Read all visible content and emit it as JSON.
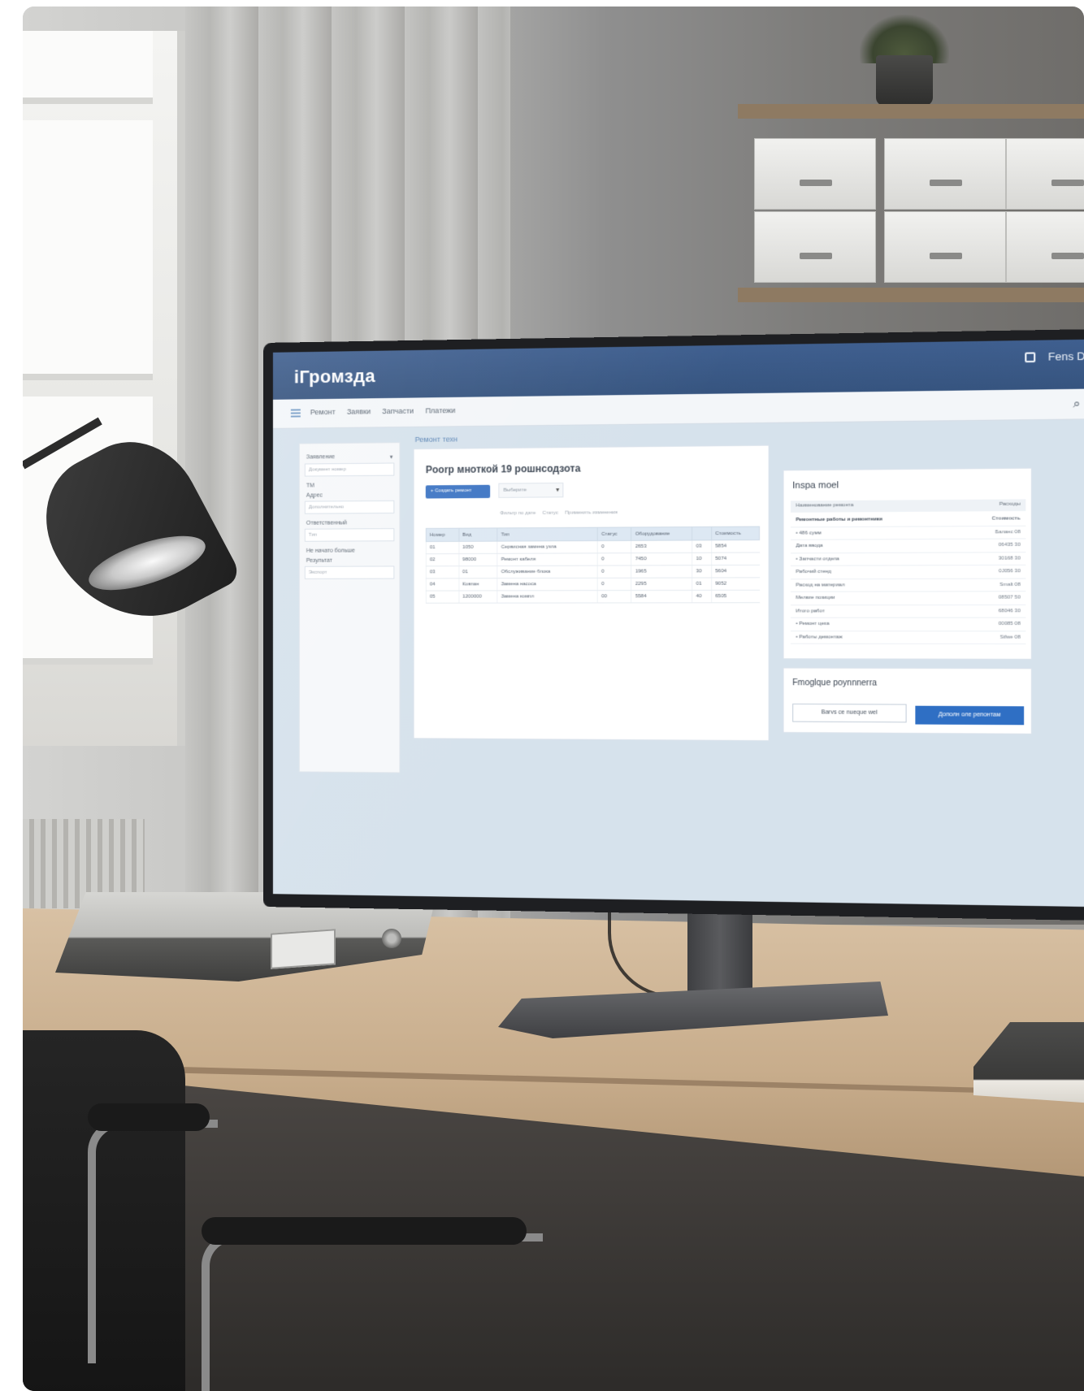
{
  "app": {
    "logo": "iГромзда",
    "user_name": "Fens Damoed"
  },
  "subnav": {
    "tabs": [
      "Ремонт",
      "Заявки",
      "Запчасти",
      "Платежи"
    ]
  },
  "sidebar": {
    "fields": [
      {
        "label": "Заявление",
        "value": "Документ номер"
      },
      {
        "label": "ТМ",
        "value": ""
      },
      {
        "label": "Адрес",
        "value": "Дополнительно"
      },
      {
        "label": "Ответственный",
        "value": "Тип"
      },
      {
        "label": "Не начато больше",
        "value": ""
      },
      {
        "label": "Результат",
        "value": "Экспорт"
      }
    ]
  },
  "main": {
    "breadcrumb": "Ремонт техн",
    "title": "Poorp мноткой 19 рошнсодзота",
    "primary_button": "+ Создать ремонт",
    "select_value": "Выберите",
    "filters": [
      "Фильтр по дате",
      "Статус",
      "Применить изменения"
    ],
    "table": {
      "headers": [
        "Номер",
        "Вид",
        "Тип",
        "",
        "Статус",
        "Оборудование",
        "",
        "Стоимость"
      ],
      "rows": [
        [
          "01",
          "1050",
          "Сервисная замена узла",
          "0",
          "2653",
          "03",
          "5854"
        ],
        [
          "02",
          "98000",
          "Ремонт кабеля",
          "0",
          "7450",
          "10",
          "5074"
        ],
        [
          "03",
          "01",
          "Обслуживание блока",
          "0",
          "1965",
          "30",
          "5604"
        ],
        [
          "04",
          "Ковпан",
          "Замена насоса",
          "0",
          "2295",
          "01",
          "9052"
        ],
        [
          "05",
          "1200000",
          "Замена компл",
          "00",
          "5584",
          "40",
          "6505"
        ]
      ]
    }
  },
  "right_panel": {
    "title": "Inspa moel",
    "head": [
      "Наименование ремонта",
      "Расходы"
    ],
    "rows": [
      {
        "label": "Ремонтные работы и ремонтники",
        "value": "Стоимость",
        "bold": true
      },
      {
        "label": "• 486 сумм",
        "value": "Баланс 08",
        "bold": false
      },
      {
        "label": "Дата ввода",
        "value": "06435 30",
        "bold": false
      },
      {
        "label": "• Запчасти отдела",
        "value": "30168 30",
        "bold": false
      },
      {
        "label": "Рабочий стенд",
        "value": "0J056 30",
        "bold": false
      },
      {
        "label": "Расход на материал",
        "value": "Smalt 08",
        "bold": false
      },
      {
        "label": "Мелкие позиции",
        "value": "08507 50",
        "bold": false
      },
      {
        "label": "Итого работ",
        "value": "68046 30",
        "bold": false
      },
      {
        "label": "• Ремонт цеха",
        "value": "00085 08",
        "bold": false
      },
      {
        "label": "• Работы демонтаж",
        "value": "Stfwe 08",
        "bold": false
      }
    ]
  },
  "action_panel": {
    "title": "Fmoglque poynnnerra",
    "secondary_button": "Barvs ce nueque wel",
    "primary_button": "Дополн оле репонтам"
  }
}
